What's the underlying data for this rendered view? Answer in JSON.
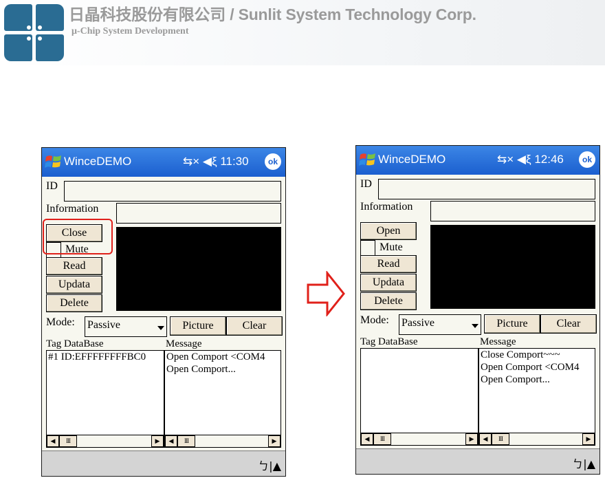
{
  "header": {
    "company": "日晶科技股份有限公司 / Sunlit System Technology Corp.",
    "tagline": "μ-Chip System Development"
  },
  "colors": {
    "titlebar": "#1b5fcf",
    "highlight": "#e0201a",
    "brand": "#2a6c93"
  },
  "screens": [
    {
      "title": "WinceDEMO",
      "status_icons": "⇆× ◀ξ",
      "time": "11:30",
      "ok_label": "ok",
      "id_label": "ID",
      "info_label": "Information",
      "id_value": "",
      "info_value": "",
      "buttons": {
        "port": "Close",
        "mute": "Mute",
        "read": "Read",
        "updata": "Updata",
        "delete": "Delete",
        "picture": "Picture",
        "clear": "Clear"
      },
      "mode_label": "Mode:",
      "mode_value": "Passive",
      "tag_label": "Tag DataBase",
      "message_label": "Message",
      "tag_lines": [
        "#1  ID:EFFFFFFFFBC0"
      ],
      "message_lines": [
        "Open Comport <COM4",
        "Open Comport..."
      ],
      "sip": "ㄅ|▲"
    },
    {
      "title": "WinceDEMO",
      "status_icons": "⇆× ◀ξ",
      "time": "12:46",
      "ok_label": "ok",
      "id_label": "ID",
      "info_label": "Information",
      "id_value": "",
      "info_value": "",
      "buttons": {
        "port": "Open",
        "mute": "Mute",
        "read": "Read",
        "updata": "Updata",
        "delete": "Delete",
        "picture": "Picture",
        "clear": "Clear"
      },
      "mode_label": "Mode:",
      "mode_value": "Passive",
      "tag_label": "Tag DataBase",
      "message_label": "Message",
      "tag_lines": [],
      "message_lines": [
        "Close Comport~~~",
        "Open Comport <COM4",
        "Open Comport..."
      ],
      "sip": "ㄅ|▲"
    }
  ]
}
